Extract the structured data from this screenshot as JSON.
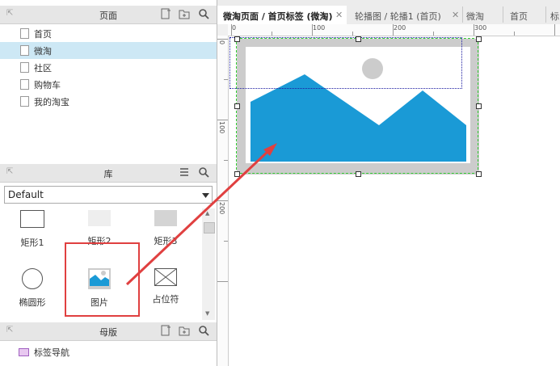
{
  "pages_panel": {
    "title": "页面",
    "items": [
      {
        "label": "首页"
      },
      {
        "label": "微淘"
      },
      {
        "label": "社区"
      },
      {
        "label": "购物车"
      },
      {
        "label": "我的淘宝"
      }
    ]
  },
  "library_panel": {
    "title": "库",
    "selected_library": "Default",
    "widgets": [
      {
        "label": "矩形1"
      },
      {
        "label": "矩形2"
      },
      {
        "label": "矩形3"
      },
      {
        "label": "椭圆形"
      },
      {
        "label": "图片"
      },
      {
        "label": "占位符"
      }
    ]
  },
  "masters_panel": {
    "title": "母版",
    "items": [
      {
        "label": "标签导航"
      }
    ]
  },
  "tabs": [
    {
      "label": "微淘页面 / 首页标签 (微淘)",
      "active": true
    },
    {
      "label": "轮播图 / 轮播1 (首页)",
      "active": false
    },
    {
      "label": "微淘",
      "active": false
    },
    {
      "label": "首页",
      "active": false
    },
    {
      "label": "标",
      "active": false
    }
  ],
  "ruler": {
    "h_labels": [
      "0",
      "100",
      "200",
      "300"
    ],
    "v_labels": [
      "0",
      "100",
      "200"
    ]
  },
  "colors": {
    "image_fill": "#1a9ad6",
    "image_frame": "#cccccc",
    "selection_green": "#33cc33",
    "selection_blue": "#1a1aa0",
    "annotation_red": "#e04040"
  }
}
